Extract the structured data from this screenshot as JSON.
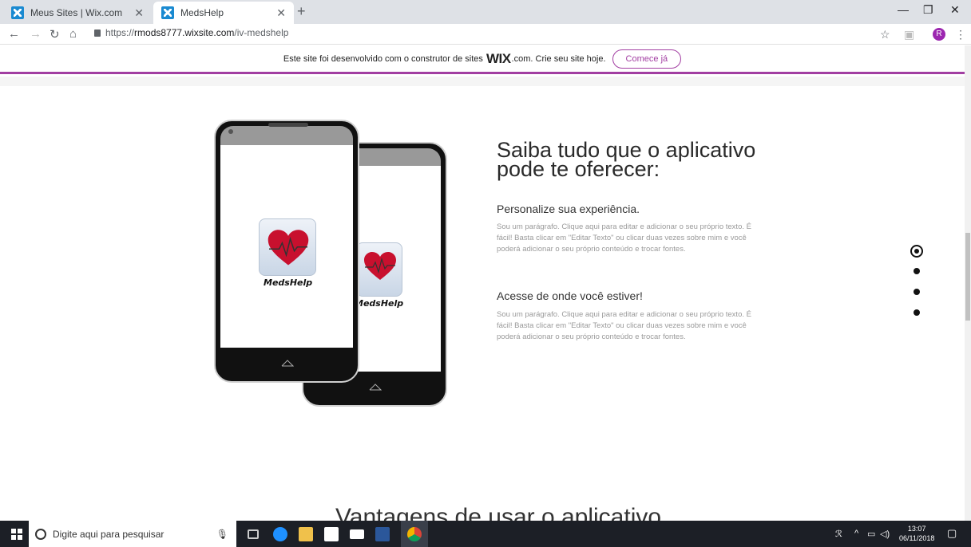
{
  "browser": {
    "tabs": [
      {
        "title": "Meus Sites | Wix.com"
      },
      {
        "title": "MedsHelp"
      }
    ],
    "url_prefix": "https://",
    "url_host": "rmods8777.wixsite.com",
    "url_path": "/iv-medshelp",
    "avatar_letter": "R"
  },
  "wix_banner": {
    "text": "Este site foi desenvolvido com o construtor de sites",
    "brand": "WIX",
    "suffix": ".com. Crie seu site hoje.",
    "button": "Comece já"
  },
  "phones": {
    "app_label_front": "MedsHelp",
    "app_label_back": "MedsHelp"
  },
  "content": {
    "heading": "Saiba tudo que o aplicativo pode te oferecer:",
    "section1_title": "Personalize sua experiência.",
    "section1_text": "Sou um parágrafo. Clique aqui para editar e adicionar o seu próprio texto. É fácil! Basta clicar em \"Editar Texto\" ou clicar duas vezes sobre mim e você poderá adicionar o seu próprio conteúdo e trocar fontes.",
    "section2_title": "Acesse de onde você estiver!",
    "section2_text": "Sou um parágrafo. Clique aqui para editar e adicionar o seu próprio texto. É fácil! Basta clicar em \"Editar Texto\" ou clicar duas vezes sobre mim e você poderá adicionar o seu próprio conteúdo e trocar fontes.",
    "next_section_peek": "Vantagens de usar o aplicativo"
  },
  "taskbar": {
    "search_placeholder": "Digite aqui para pesquisar",
    "time": "13:07",
    "date": "06/11/2018"
  },
  "colors": {
    "wix_accent": "#a23ea2",
    "heart_red": "#c8102e"
  }
}
